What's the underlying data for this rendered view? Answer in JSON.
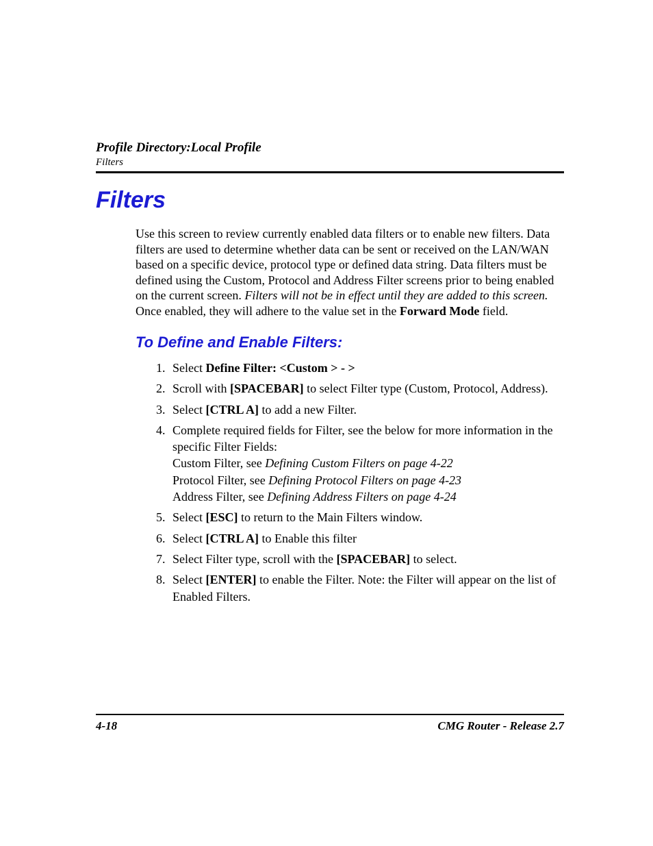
{
  "header": {
    "title": "Profile Directory:Local Profile",
    "subtitle": "Filters"
  },
  "section_title": "Filters",
  "intro": {
    "p1a": "Use this screen to review currently enabled data filters or to enable new filters. Data filters are used to determine whether data can be sent or received on the LAN/WAN based on a specific device, protocol type or defined data string. Data filters must be defined using the Custom, Protocol and Address Filter screens prior to being enabled on the current screen. ",
    "p1_ital": "Filters will not be in effect until they are added to this screen.",
    "p1b": " Once enabled, they will adhere to the value set in the ",
    "p1_bold": "Forward Mode",
    "p1c": " field."
  },
  "subheading": "To Define and Enable Filters:",
  "steps": {
    "s1a": "Select ",
    "s1b": "Define Filter: <Custom > - >",
    "s2a": "Scroll with ",
    "s2key": "[SPACEBAR]",
    "s2b": " to select Filter type (Custom, Protocol, Address).",
    "s3a": "Select ",
    "s3key": "[CTRL A]",
    "s3b": " to add a new Filter.",
    "s4a": "Complete required fields for Filter, see the below for more information in the specific Filter Fields:",
    "s4l1a": "Custom Filter, see ",
    "s4l1b": "Defining Custom Filters on page 4-22",
    "s4l2a": "Protocol Filter, see ",
    "s4l2b": "Defining Protocol Filters on page 4-23",
    "s4l3a": "Address Filter, see ",
    "s4l3b": "Defining Address Filters on page 4-24",
    "s5a": "Select ",
    "s5key": "[ESC]",
    "s5b": " to return to the Main Filters window.",
    "s6a": "Select ",
    "s6key": "[CTRL A]",
    "s6b": " to Enable this filter",
    "s7a": "Select Filter type, scroll with the ",
    "s7key": "[SPACEBAR]",
    "s7b": " to select.",
    "s8a": "Select ",
    "s8key": "[ENTER]",
    "s8b": " to enable the Filter. Note: the Filter will appear on the list of Enabled Filters."
  },
  "footer": {
    "page": "4-18",
    "doc": "CMG Router - Release 2.7"
  }
}
